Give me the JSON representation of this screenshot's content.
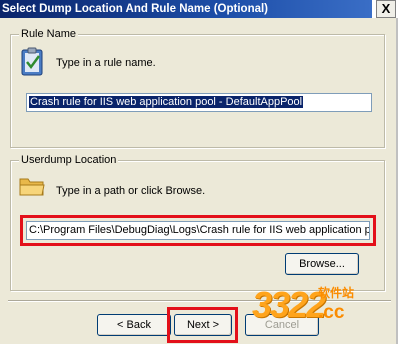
{
  "window": {
    "title": "Select Dump Location And Rule Name (Optional)",
    "close_label": "X"
  },
  "rule_group": {
    "legend": "Rule Name",
    "icon": "rule-clipboard-icon",
    "help": "Type in a rule name.",
    "input_value": "Crash rule for IIS web application pool - DefaultAppPool"
  },
  "dump_group": {
    "legend": "Userdump Location",
    "icon": "folder-icon",
    "help": "Type in a path or click Browse.",
    "input_value": "C:\\Program Files\\DebugDiag\\Logs\\Crash rule for IIS web application pool - Defau",
    "browse_label": "Browse..."
  },
  "footer": {
    "back_label": "< Back",
    "next_label": "Next >",
    "cancel_label": "Cancel"
  },
  "watermark": {
    "logo_text": "3322",
    "top_text": "软件站",
    "bottom_text": ".cc"
  },
  "colors": {
    "title_bar": "#0a246a",
    "dialog_bg": "#ece9d8",
    "highlight_red": "#e3101a",
    "watermark_orange": "#fb8c00"
  }
}
